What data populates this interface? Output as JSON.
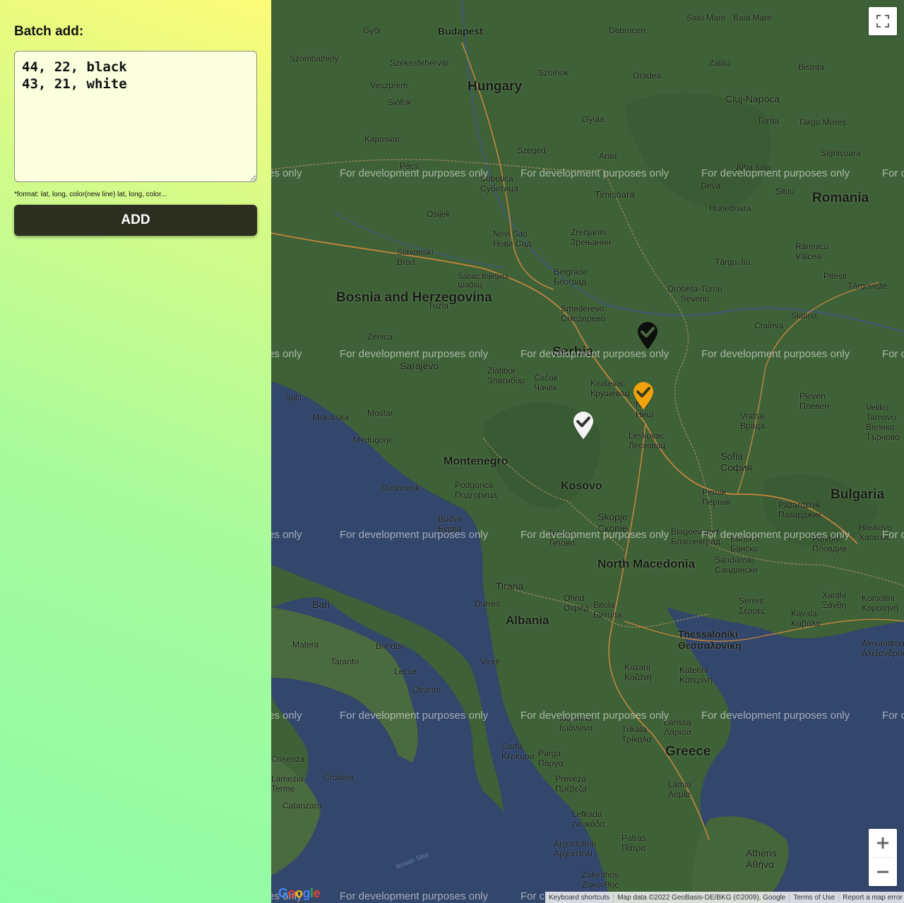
{
  "sidebar": {
    "heading": "Batch add:",
    "textarea_value": "44, 22, black\n43, 21, white",
    "hint": "*format: lat, long, color(new line) lat, long, color...",
    "add_label": "ADD"
  },
  "map": {
    "watermark": "For development purposes only",
    "watermark_edge": "es only",
    "watermark_edge_right": "For c",
    "countries": [
      "Hungary",
      "Romania",
      "Bosnia and Herzegovina",
      "Serbia",
      "Montenegro",
      "Kosovo",
      "North Macedonia",
      "Albania",
      "Bulgaria",
      "Greece"
    ],
    "cities": [
      "Budapest",
      "Győr",
      "Debrecen",
      "Satu Mare",
      "Baia Mare",
      "Szombathely",
      "Székesfehérvár",
      "Szolnok",
      "Oradea",
      "Bistrița",
      "Cluj-Napoca",
      "Veszprém",
      "Siófok",
      "Zalău",
      "Turda",
      "Târgu Mureș",
      "Kaposvár",
      "Szeged",
      "Gyula",
      "Arad",
      "Sighișoara",
      "Pécs",
      "Subotica Суботица",
      "Timișoara",
      "Deva",
      "Alba Iulia",
      "Sibiu",
      "Hunedoara",
      "Osijek",
      "Novi Sad Нови Сад",
      "Zrenjanin Зрењанин",
      "Slavonski Brod",
      "Belgrade Београд",
      "Šabac Bijeljina Шабац",
      "Tuzla",
      "Râmnicu Vâlcea",
      "Pitești",
      "Târgoviște",
      "Târgu Jiu",
      "Drobeta-Turnu Severin",
      "Smederevo Смедерево",
      "Zenica",
      "Craiova",
      "Slatina",
      "Sarajevo",
      "Zlatibor Златибор",
      "Čačak Чачак",
      "Kruševac Крушевац",
      "Niš Ниш",
      "Pleven Плевен",
      "Veliko Tarnovo Велико Търново",
      "Split",
      "Mostar",
      "Makarska",
      "Medugorje",
      "Leskovac Лесковац",
      "Vratsa Враца",
      "Sofia София",
      "Dubrovnik",
      "Podgorica Подгорица",
      "Pernik Перник",
      "Pazardzhik Пазарджик",
      "Skopje Скопје",
      "Budva Будва",
      "Tetovo Тетово",
      "Blagoevgrad Благоевград",
      "Bansko Банско",
      "Plovdiv Пловдив",
      "Haskovo Хасково",
      "Sandanski Сандански",
      "Tirana",
      "Durrës",
      "Ohrid Охрид",
      "Bitola Битола",
      "Serres Σέρρες",
      "Xanthi Ξάνθη",
      "Komotini Κομοτηνή",
      "Kavala Καβάλα",
      "Thessaloniki Θεσσαλονίκη",
      "Bari",
      "Matera",
      "Brindisi",
      "Taranto",
      "Lecce",
      "Otranto",
      "Vlorë",
      "Kozani Κοζάνη",
      "Katerini Κατερίνη",
      "Ioannina Ιωάννινα",
      "Trikala Τρίκαλα",
      "Larissa Λάρισα",
      "Alexandroupoli Αλεξανδρούπολη",
      "Corfu Κέρκυρα",
      "Parga Πάργα",
      "Preveza Πρέβεζα",
      "Lamia Λαμία",
      "Crotone",
      "Catanzaro",
      "Lamezia Terme",
      "Cosenza",
      "Lefkada Λευκάδα",
      "Argostolion Αργοστόλι",
      "Patras Πάτρα",
      "Athens Αθήνα",
      "Zakinthos Ζάκυνθος",
      "Ionian Sea"
    ],
    "markers": [
      {
        "color": "black",
        "lat": 44,
        "long": 22
      },
      {
        "color": "white",
        "lat": 43,
        "long": 21
      },
      {
        "color": "orange",
        "lat": 43.3,
        "long": 21.9
      }
    ],
    "attribution": {
      "logo": "Google",
      "keyboard": "Keyboard shortcuts",
      "data": "Map data ©2022 GeoBasis-DE/BKG (©2009), Google",
      "terms": "Terms of Use",
      "report": "Report a map error"
    }
  }
}
